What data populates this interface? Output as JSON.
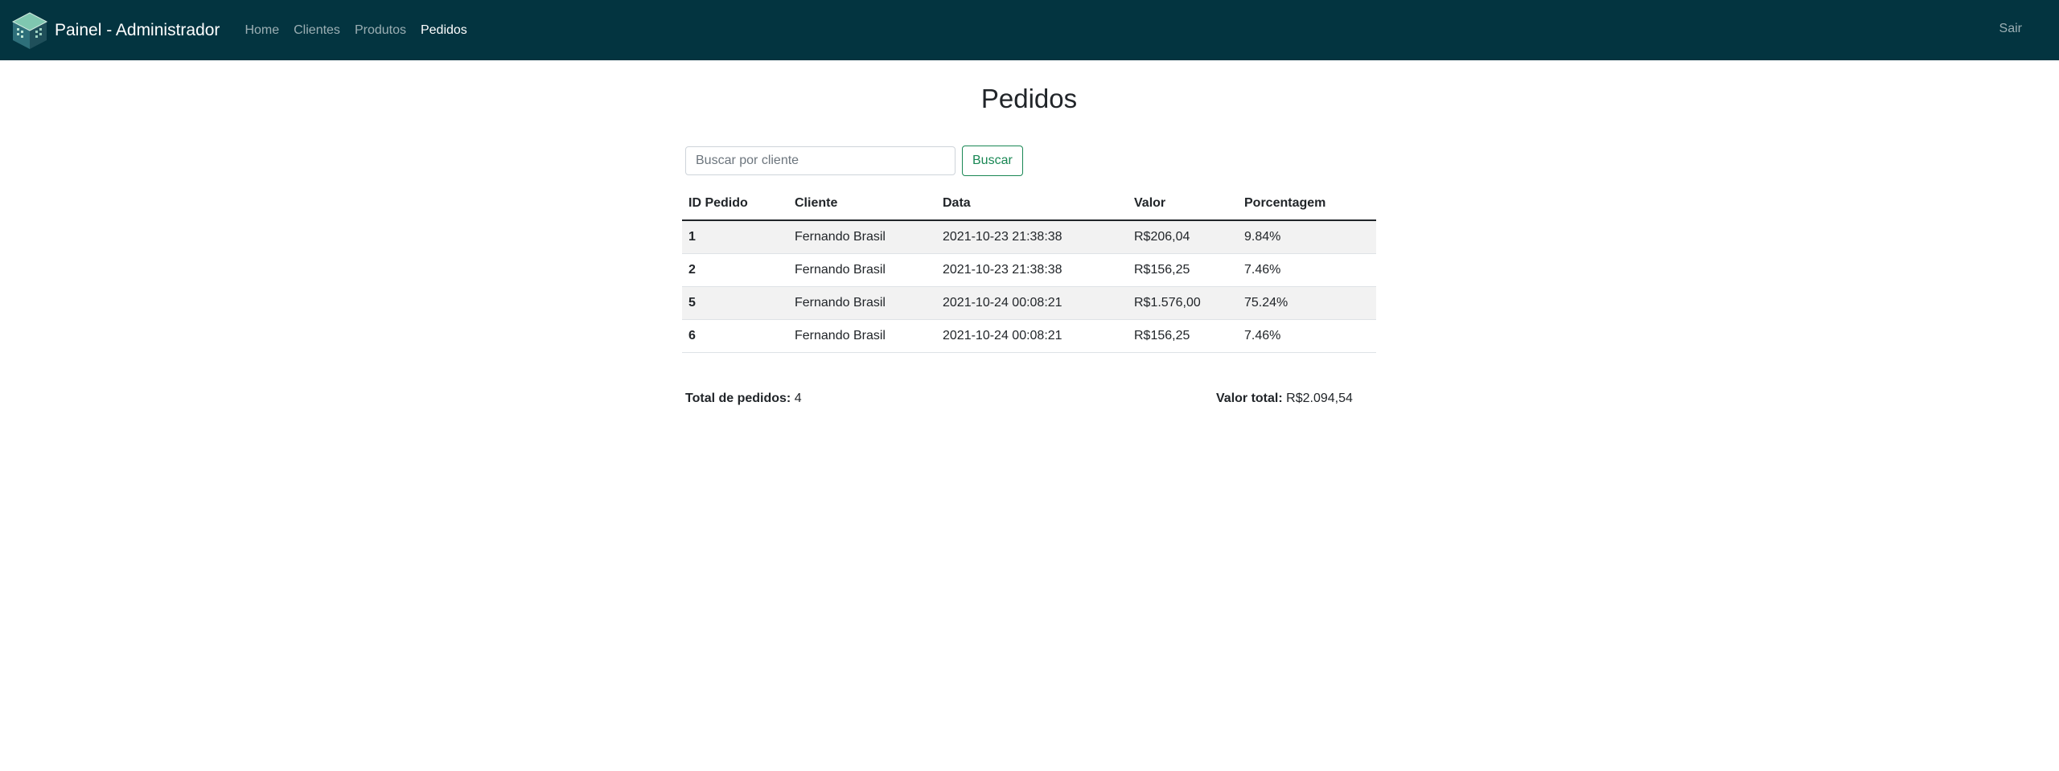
{
  "navbar": {
    "brand": "Painel - Administrador",
    "links": [
      {
        "label": "Home"
      },
      {
        "label": "Clientes"
      },
      {
        "label": "Produtos"
      },
      {
        "label": "Pedidos"
      }
    ],
    "active_link": "Pedidos",
    "logout_label": "Sair",
    "background_color": "#033440"
  },
  "page": {
    "title": "Pedidos"
  },
  "search": {
    "placeholder": "Buscar por cliente",
    "value": "",
    "button_label": "Buscar"
  },
  "table": {
    "headers": [
      "ID Pedido",
      "Cliente",
      "Data",
      "Valor",
      "Porcentagem"
    ],
    "rows": [
      [
        "1",
        "Fernando Brasil",
        "2021-10-23 21:38:38",
        "R$206,04",
        "9.84%"
      ],
      [
        "2",
        "Fernando Brasil",
        "2021-10-23 21:38:38",
        "R$156,25",
        "7.46%"
      ],
      [
        "5",
        "Fernando Brasil",
        "2021-10-24 00:08:21",
        "R$1.576,00",
        "75.24%"
      ],
      [
        "6",
        "Fernando Brasil",
        "2021-10-24 00:08:21",
        "R$156,25",
        "7.46%"
      ]
    ]
  },
  "summary": {
    "total_orders_label": "Total de pedidos:",
    "total_orders_value": "4",
    "total_value_label": "Valor total:",
    "total_value_value": "R$2.094,54"
  },
  "icons": {
    "brand_logo": "cube-logo-icon"
  }
}
